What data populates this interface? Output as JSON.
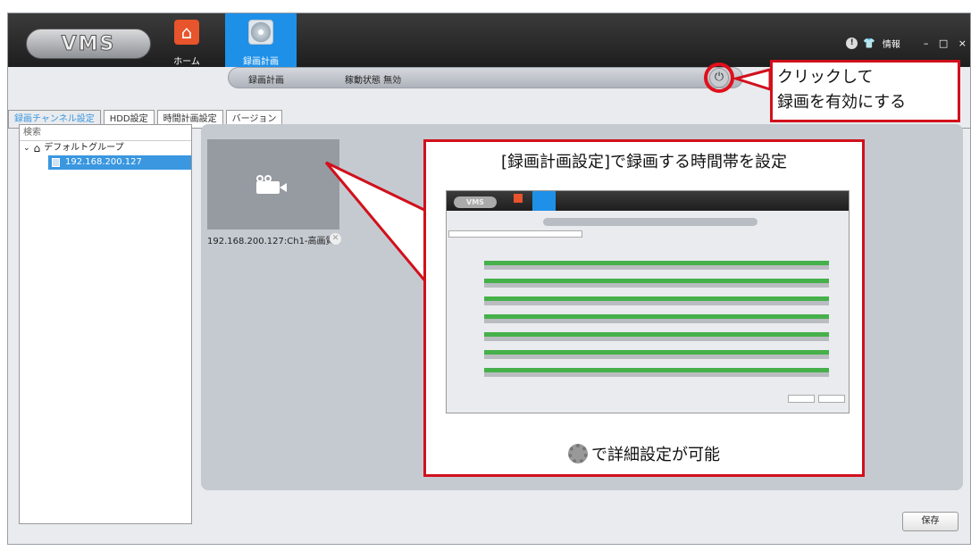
{
  "app": {
    "logo": "VMS",
    "nav": [
      {
        "label": "ホーム",
        "icon": "home-icon"
      },
      {
        "label": "録画計画",
        "icon": "record-disc-icon"
      }
    ],
    "info_label": "情報",
    "window_controls": "– □ ×"
  },
  "status": {
    "title": "録画計画",
    "state": "稼動状態 無効"
  },
  "tabs": [
    {
      "label": "録画チャンネル設定",
      "active": true
    },
    {
      "label": "HDD設定",
      "active": false
    },
    {
      "label": "時間計画設定",
      "active": false
    },
    {
      "label": "バージョン",
      "active": false
    }
  ],
  "tree": {
    "search_placeholder": "検索",
    "group": "デフォルトグループ",
    "item": "192.168.200.127"
  },
  "channel": {
    "caption": "192.168.200.127:Ch1-高画質"
  },
  "save_label": "保存",
  "callouts": {
    "power": [
      "クリックして",
      "録画を有効にする"
    ],
    "schedule_title": "[録画計画設定]で録画する時間帯を設定",
    "schedule_footer": "で詳細設定が可能"
  },
  "colors": {
    "accent": "#1e90e8",
    "callout_border": "#d1101c",
    "schedule_green": "#46b04a"
  }
}
